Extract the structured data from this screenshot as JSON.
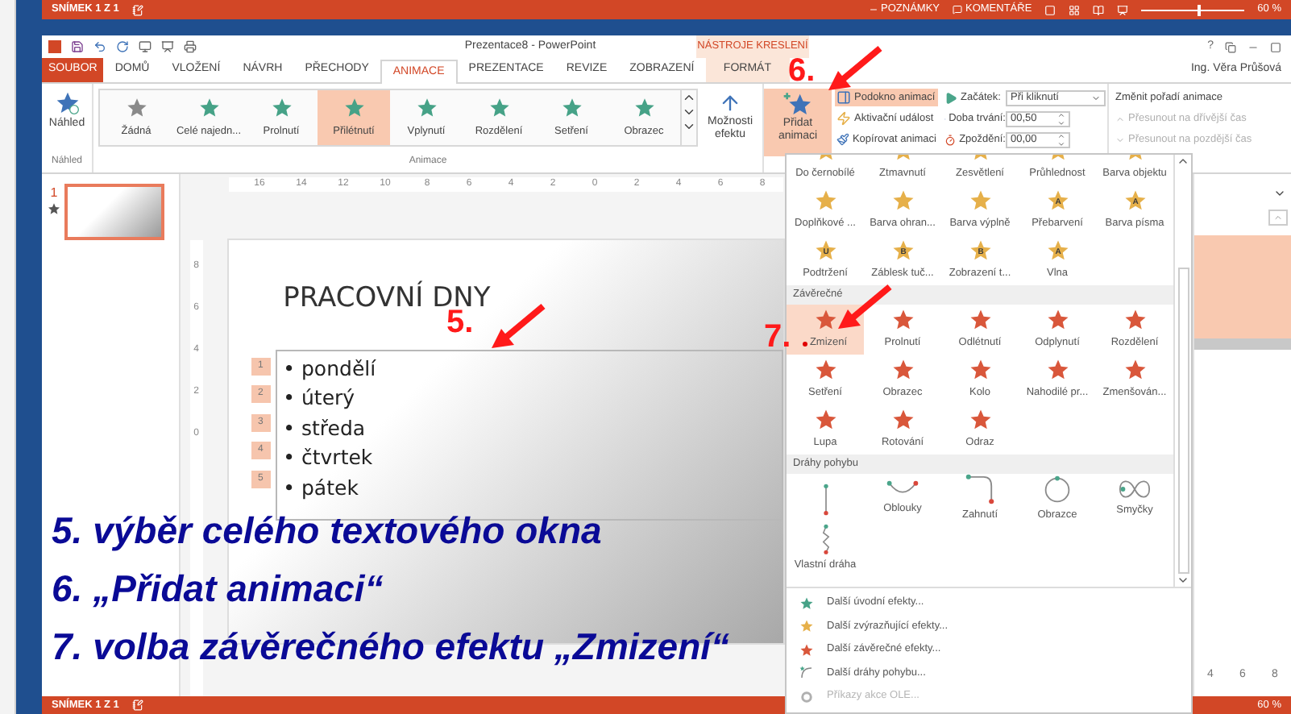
{
  "status_top": {
    "slide_info": "SNÍMEK 1 Z 1",
    "notes": "POZNÁMKY",
    "comments": "KOMENTÁŘE",
    "zoom": "60 %",
    "zoom_slider": {
      "level": 0.55
    }
  },
  "title_bar": {
    "title": "Prezentace8 - PowerPoint",
    "context_group": "NÁSTROJE KRESLENÍ",
    "help": "?"
  },
  "tabs": [
    {
      "label": "SOUBOR",
      "kind": "file",
      "selected": false
    },
    {
      "label": "DOMŮ",
      "kind": "normal",
      "selected": false
    },
    {
      "label": "VLOŽENÍ",
      "kind": "normal",
      "selected": false
    },
    {
      "label": "NÁVRH",
      "kind": "normal",
      "selected": false
    },
    {
      "label": "PŘECHODY",
      "kind": "normal",
      "selected": false
    },
    {
      "label": "ANIMACE",
      "kind": "normal",
      "selected": true
    },
    {
      "label": "PREZENTACE",
      "kind": "normal",
      "selected": false
    },
    {
      "label": "REVIZE",
      "kind": "normal",
      "selected": false
    },
    {
      "label": "ZOBRAZENÍ",
      "kind": "normal",
      "selected": false
    },
    {
      "label": "FORMÁT",
      "kind": "context",
      "selected": false
    }
  ],
  "user": "Ing. Věra Průšová",
  "ribbon": {
    "preview": {
      "label": "Náhled",
      "group": "Náhled"
    },
    "gallery": {
      "group": "Animace",
      "items": [
        {
          "label": "Žádná",
          "kind": "none",
          "selected": false
        },
        {
          "label": "Celé najedn...",
          "kind": "entrance",
          "selected": false
        },
        {
          "label": "Prolnutí",
          "kind": "entrance",
          "selected": false
        },
        {
          "label": "Přilétnutí",
          "kind": "entrance",
          "selected": true
        },
        {
          "label": "Vplynutí",
          "kind": "entrance",
          "selected": false
        },
        {
          "label": "Rozdělení",
          "kind": "entrance",
          "selected": false
        },
        {
          "label": "Setření",
          "kind": "entrance",
          "selected": false
        },
        {
          "label": "Obrazec",
          "kind": "entrance",
          "selected": false
        }
      ]
    },
    "effect_options": "Možnosti efektu",
    "add_animation": {
      "label": "Přidat animaci",
      "selected": true
    },
    "small_buttons": [
      {
        "label": "Podokno animací",
        "selected": true
      },
      {
        "label": "Aktivační událost",
        "selected": false
      },
      {
        "label": "Kopírovat animaci",
        "selected": false
      }
    ],
    "timing": [
      {
        "label": "Začátek:",
        "kind": "select",
        "value": "Při kliknutí"
      },
      {
        "label": "Doba trvání:",
        "kind": "spin",
        "value": "00,50"
      },
      {
        "label": "Zpoždění:",
        "kind": "spin",
        "value": "00,00"
      }
    ],
    "reorder": {
      "title": "Změnit pořadí animace",
      "items": [
        {
          "label": "Přesunout na dřívější čas",
          "disabled": true
        },
        {
          "label": "Přesunout na pozdější čas",
          "disabled": true
        }
      ]
    }
  },
  "thumbnails": [
    {
      "number": "1",
      "selected": true
    }
  ],
  "rulers": {
    "horizontal": [
      "16",
      "14",
      "12",
      "10",
      "8",
      "6",
      "4",
      "2",
      "0",
      "2",
      "4",
      "6",
      "8"
    ],
    "vertical": [
      "8",
      "6",
      "4",
      "2",
      "0"
    ]
  },
  "slide": {
    "title": "PRACOVNÍ DNY",
    "bullets": [
      {
        "tag": "1",
        "text": "• pondělí"
      },
      {
        "tag": "2",
        "text": "• úterý"
      },
      {
        "tag": "3",
        "text": "• středa"
      },
      {
        "tag": "4",
        "text": "• čtvrtek"
      },
      {
        "tag": "5",
        "text": "• pátek"
      }
    ]
  },
  "right_pane": {
    "ruler": [
      "4",
      "6",
      "8"
    ]
  },
  "animation_menu": {
    "sections": [
      {
        "kind": "emphasis",
        "items": [
          {
            "label": "Do černobílé"
          },
          {
            "label": "Ztmavnutí"
          },
          {
            "label": "Zesvětlení"
          },
          {
            "label": "Průhlednost"
          },
          {
            "label": "Barva objektu"
          }
        ]
      },
      {
        "kind": "emphasis",
        "items": [
          {
            "label": "Doplňkové ..."
          },
          {
            "label": "Barva ohran..."
          },
          {
            "label": "Barva výplně"
          },
          {
            "label": "Přebarvení",
            "glyph": "A"
          },
          {
            "label": "Barva písma",
            "glyph": "A"
          }
        ]
      },
      {
        "kind": "emphasis",
        "items": [
          {
            "label": "Podtržení",
            "glyph": "U"
          },
          {
            "label": "Záblesk tuč...",
            "glyph": "B"
          },
          {
            "label": "Zobrazení t...",
            "glyph": "B"
          },
          {
            "label": "Vlna",
            "glyph": "A"
          }
        ]
      },
      {
        "kind": "exit",
        "heading": "Závěrečné",
        "items": [
          {
            "label": "Zmizení",
            "selected": true
          },
          {
            "label": "Prolnutí",
            "selected": false
          },
          {
            "label": "Odlétnutí",
            "selected": false
          },
          {
            "label": "Odplynutí",
            "selected": false
          },
          {
            "label": "Rozdělení",
            "selected": false
          }
        ]
      },
      {
        "kind": "exit",
        "items": [
          {
            "label": "Setření",
            "selected": false
          },
          {
            "label": "Obrazec",
            "selected": false
          },
          {
            "label": "Kolo",
            "selected": false
          },
          {
            "label": "Nahodilé pr...",
            "selected": false
          },
          {
            "label": "Zmenšován...",
            "selected": false
          }
        ]
      },
      {
        "kind": "exit",
        "items": [
          {
            "label": "Lupa",
            "selected": false
          },
          {
            "label": "Rotování",
            "selected": false
          },
          {
            "label": "Odraz",
            "selected": false
          }
        ]
      },
      {
        "kind": "motion",
        "heading": "Dráhy pohybu",
        "items": [
          {
            "kind": "line"
          },
          {
            "label": "Oblouky",
            "kind": "arc"
          },
          {
            "label": "Zahnutí",
            "kind": "turn"
          },
          {
            "label": "Obrazce",
            "kind": "circle"
          },
          {
            "label": "Smyčky",
            "kind": "loop"
          }
        ]
      },
      {
        "kind": "motion",
        "items": [
          {
            "label": "Vlastní dráha",
            "kind": "custom"
          }
        ]
      }
    ],
    "more": [
      {
        "label": "Další úvodní efekty...",
        "kind": "entrance",
        "disabled": false
      },
      {
        "label": "Další zvýrazňující efekty...",
        "kind": "emphasis",
        "disabled": false
      },
      {
        "label": "Další závěrečné efekty...",
        "kind": "exit",
        "disabled": false
      },
      {
        "label": "Další dráhy pohybu...",
        "kind": "motion",
        "disabled": false
      },
      {
        "label": "Příkazy akce OLE...",
        "kind": "ole",
        "disabled": true
      }
    ]
  },
  "annotations": {
    "markers": [
      "5.",
      "6.",
      "7."
    ],
    "lines": [
      "5. výběr celého textového okna",
      "6. „Přidat animaci“",
      "7. volba závěrečného efektu „Zmizení“"
    ]
  },
  "status_bottom": {
    "slide_info": "SNÍMEK 1 Z 1",
    "zoom": "60 %"
  }
}
